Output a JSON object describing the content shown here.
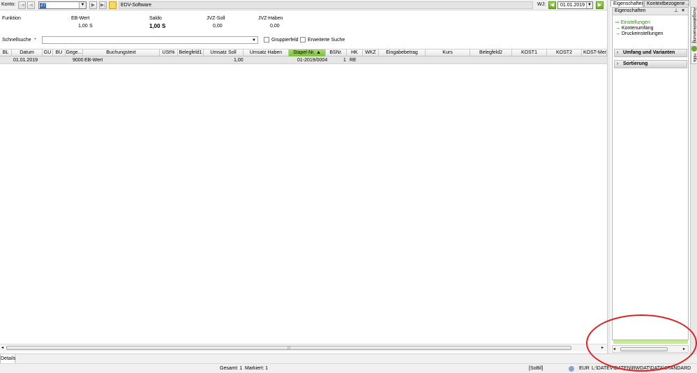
{
  "toolbar": {
    "konto_label": "Konto:",
    "account_value": "27",
    "account_name": "EDV-Software",
    "wj_label": "WJ:",
    "wj_value": "01.01.2019"
  },
  "summary": {
    "funktion_label": "Funktion",
    "eb_label": "EB-Wert",
    "eb_value": "1,00",
    "eb_side": "S",
    "saldo_label": "Saldo",
    "saldo_value": "1,00",
    "saldo_side": "S",
    "jvz_soll_label": "JVZ-Soll",
    "jvz_soll_value": "0,00",
    "jvz_haben_label": "JVZ-Haben",
    "jvz_haben_value": "0,00"
  },
  "search": {
    "label": "Schnellsuche",
    "star": "*",
    "value": "",
    "gruppierfeld": "Gruppierfeld",
    "erweitert": "Erweiterte Suche"
  },
  "table": {
    "columns": [
      "BL",
      "Datum",
      "GU",
      "BU",
      "Gege...",
      "Buchungstext",
      "USt%",
      "Belegfeld1",
      "Umsatz Soll",
      "Umsatz Haben",
      "Stapel-Nr.",
      "BSNr.",
      "HK",
      "WKZ",
      "Eingabebetrag",
      "Kurs",
      "Belegfeld2",
      "KOST1",
      "KOST2",
      "KOST-Men"
    ],
    "rows": [
      {
        "bl": "",
        "datum": "01.01.2019",
        "gu": "",
        "bu": "",
        "gegen": "9000",
        "text": "EB-Wert",
        "ust": "",
        "beleg1": "",
        "soll": "1,00",
        "haben": "",
        "stapel": "01-2019/0004",
        "bsnr": "1",
        "hk": "RE",
        "wkz": "",
        "eingabe": "",
        "kurs": "",
        "beleg2": "",
        "kost1": "",
        "kost2": "",
        "kostmen": ""
      }
    ]
  },
  "bottom": {
    "details_tab": "Details",
    "gesamt": "Gesamt: 1",
    "markiert": "Markiert: 1",
    "mode": "[SoBil]",
    "currency": "EUR",
    "path": "L:\\DATEV\\DATEN\\RWDAT\\DATA\\STANDARD"
  },
  "panel": {
    "tab1": "Eigenschaften",
    "tab2": "Kontextbezogene ...",
    "title": "Eigenschaften",
    "pin": "⊥",
    "close": "×",
    "links": [
      "Einstellungen",
      "Kontenumfang",
      "Druckeinstellungen"
    ],
    "section1": "Umfang und Varianten",
    "section2": "Sortierung",
    "vtab1": "Ausgabesteuerung",
    "vtab2": "Hilfe"
  }
}
